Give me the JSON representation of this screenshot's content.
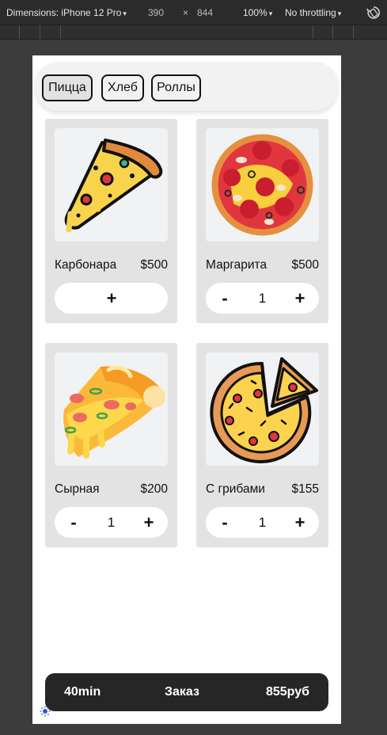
{
  "devtools": {
    "dimensions_label": "Dimensions: iPhone 12 Pro",
    "width": "390",
    "times": "×",
    "height": "844",
    "zoom": "100%",
    "throttling": "No throttling",
    "caret": "▾"
  },
  "tabs": [
    {
      "label": "Пицца"
    },
    {
      "label": "Хлеб"
    },
    {
      "label": "Роллы"
    }
  ],
  "products": [
    {
      "name": "Карбонара",
      "price": "$500",
      "qty": "",
      "plus": "+",
      "minus": ""
    },
    {
      "name": "Маргарита",
      "price": "$500",
      "qty": "1",
      "plus": "+",
      "minus": "-"
    },
    {
      "name": "Сырная",
      "price": "$200",
      "qty": "1",
      "plus": "+",
      "minus": "-"
    },
    {
      "name": "С грибами",
      "price": "$155",
      "qty": "1",
      "plus": "+",
      "minus": "-"
    }
  ],
  "order": {
    "time": "40min",
    "label": "Заказ",
    "total": "855руб"
  },
  "colors": {
    "order_bar": "#262626",
    "card_bg": "#e3e3e3",
    "accent_red": "#e2363f"
  }
}
